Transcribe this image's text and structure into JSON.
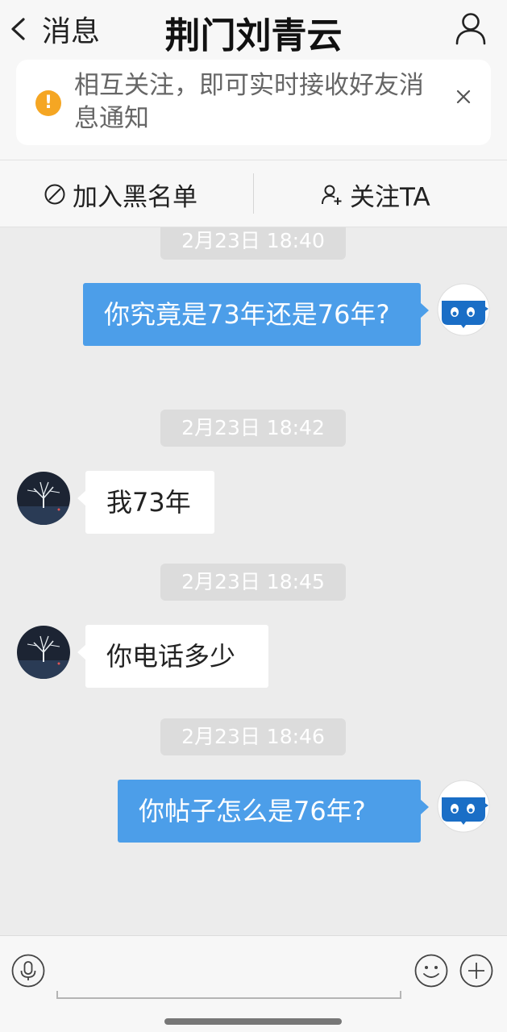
{
  "header": {
    "back_label": "消息",
    "title": "荆门刘青云"
  },
  "notice": {
    "text": "相互关注，即可实时接收好友消息通知"
  },
  "actions": {
    "block_label": "加入黑名单",
    "follow_label": "关注TA"
  },
  "messages": [
    {
      "timestamp": "2月23日 18:40",
      "sender": "me",
      "text": "你究竟是73年还是76年?"
    },
    {
      "timestamp": "2月23日 18:42",
      "sender": "other",
      "text": "我73年"
    },
    {
      "timestamp": "2月23日 18:45",
      "sender": "other",
      "text": "你电话多少"
    },
    {
      "timestamp": "2月23日 18:46",
      "sender": "me",
      "text": "你帖子怎么是76年?"
    }
  ],
  "input": {
    "value": ""
  },
  "colors": {
    "outgoing_bubble": "#4c9ee9",
    "incoming_bubble": "#ffffff",
    "notice_icon": "#f5a623",
    "background": "#ececec"
  },
  "icons": [
    "back-chevron-icon",
    "user-profile-icon",
    "warning-icon",
    "close-icon",
    "block-icon",
    "add-user-icon",
    "microphone-icon",
    "emoji-icon",
    "plus-icon"
  ]
}
